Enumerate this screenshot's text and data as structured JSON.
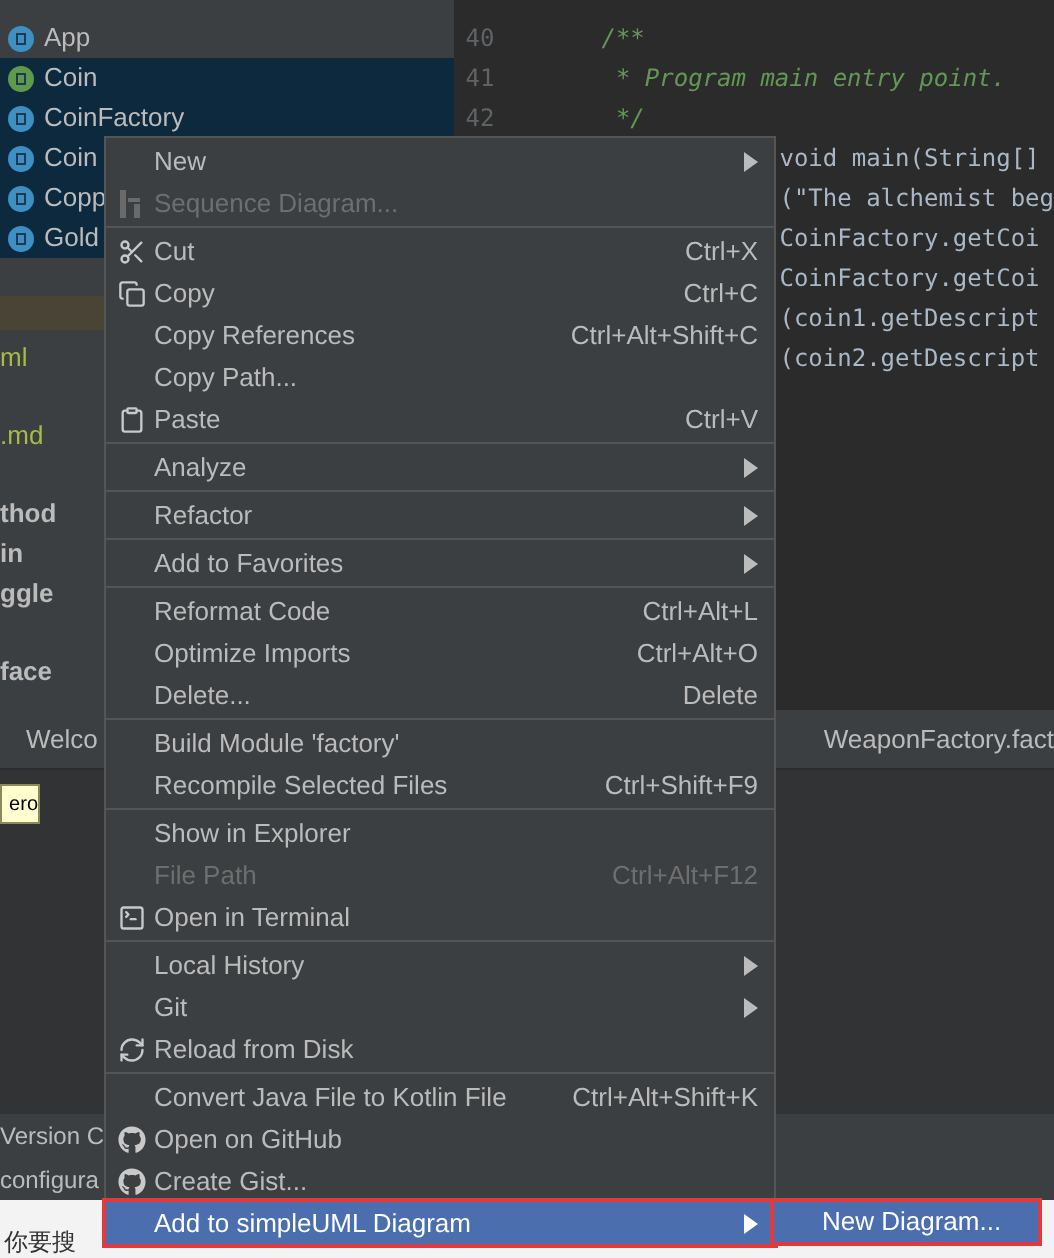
{
  "project_tree": {
    "items": [
      {
        "label": "App",
        "kind": "class",
        "selected": false
      },
      {
        "label": "Coin",
        "kind": "interface",
        "selected": true
      },
      {
        "label": "CoinFactory",
        "kind": "class",
        "selected": true
      },
      {
        "label": "Coin",
        "kind": "enum",
        "selected": true
      },
      {
        "label": "Copp",
        "kind": "class",
        "selected": true
      },
      {
        "label": "Gold",
        "kind": "class",
        "selected": true
      }
    ],
    "fragments": [
      {
        "text": "ml",
        "kind": "file"
      },
      {
        "text": ".md",
        "kind": "file"
      },
      {
        "text": "thod",
        "kind": "bold"
      },
      {
        "text": "in",
        "kind": "bold"
      },
      {
        "text": "ggle",
        "kind": "bold"
      },
      {
        "text": "face",
        "kind": "bold"
      }
    ]
  },
  "editor": {
    "lines": [
      {
        "number": "40",
        "code": "/**",
        "kind": "comment"
      },
      {
        "number": "41",
        "code": " * Program main entry point.",
        "kind": "comment"
      },
      {
        "number": "42",
        "code": " */",
        "kind": "comment"
      }
    ],
    "visible_code": [
      "void main(String[]",
      "(\"The alchemist beg",
      "CoinFactory.getCoi",
      "CoinFactory.getCoi",
      "(coin1.getDescript",
      "(coin2.getDescript"
    ]
  },
  "tool_tabs": [
    "Welco",
    "WeaponFactory.fact"
  ],
  "diagram": {
    "node": "ero"
  },
  "status_lines": [
    "Version C",
    "configura"
  ],
  "taskbar": {
    "search_text": "你要搜"
  },
  "context_menu": {
    "items": [
      {
        "kind": "plain",
        "label": "New",
        "submenu": true,
        "disabled": false,
        "selected": false
      },
      {
        "kind": "sequence",
        "label": "Sequence Diagram...",
        "submenu": false,
        "disabled": true,
        "selected": false
      },
      {
        "kind": "separator"
      },
      {
        "kind": "cut",
        "label": "Cut",
        "shortcut": "Ctrl+X",
        "submenu": false,
        "disabled": false,
        "selected": false
      },
      {
        "kind": "copy",
        "label": "Copy",
        "shortcut": "Ctrl+C",
        "submenu": false,
        "disabled": false,
        "selected": false
      },
      {
        "kind": "plain",
        "label": "Copy References",
        "shortcut": "Ctrl+Alt+Shift+C",
        "submenu": false,
        "disabled": false,
        "selected": false
      },
      {
        "kind": "plain",
        "label": "Copy Path...",
        "submenu": false,
        "disabled": false,
        "selected": false
      },
      {
        "kind": "paste",
        "label": "Paste",
        "shortcut": "Ctrl+V",
        "submenu": false,
        "disabled": false,
        "selected": false
      },
      {
        "kind": "separator"
      },
      {
        "kind": "plain",
        "label": "Analyze",
        "submenu": true,
        "disabled": false,
        "selected": false
      },
      {
        "kind": "separator"
      },
      {
        "kind": "plain",
        "label": "Refactor",
        "submenu": true,
        "disabled": false,
        "selected": false
      },
      {
        "kind": "separator"
      },
      {
        "kind": "plain",
        "label": "Add to Favorites",
        "submenu": true,
        "disabled": false,
        "selected": false
      },
      {
        "kind": "separator"
      },
      {
        "kind": "plain",
        "label": "Reformat Code",
        "shortcut": "Ctrl+Alt+L",
        "submenu": false,
        "disabled": false,
        "selected": false
      },
      {
        "kind": "plain",
        "label": "Optimize Imports",
        "shortcut": "Ctrl+Alt+O",
        "submenu": false,
        "disabled": false,
        "selected": false
      },
      {
        "kind": "plain",
        "label": "Delete...",
        "shortcut": "Delete",
        "submenu": false,
        "disabled": false,
        "selected": false
      },
      {
        "kind": "separator"
      },
      {
        "kind": "plain",
        "label": "Build Module 'factory'",
        "submenu": false,
        "disabled": false,
        "selected": false
      },
      {
        "kind": "plain",
        "label": "Recompile Selected Files",
        "shortcut": "Ctrl+Shift+F9",
        "submenu": false,
        "disabled": false,
        "selected": false
      },
      {
        "kind": "separator"
      },
      {
        "kind": "plain",
        "label": "Show in Explorer",
        "submenu": false,
        "disabled": false,
        "selected": false
      },
      {
        "kind": "plain",
        "label": "File Path",
        "shortcut": "Ctrl+Alt+F12",
        "submenu": false,
        "disabled": true,
        "selected": false
      },
      {
        "kind": "terminal",
        "label": "Open in Terminal",
        "submenu": false,
        "disabled": false,
        "selected": false
      },
      {
        "kind": "separator"
      },
      {
        "kind": "plain",
        "label": "Local History",
        "submenu": true,
        "disabled": false,
        "selected": false
      },
      {
        "kind": "plain",
        "label": "Git",
        "submenu": true,
        "disabled": false,
        "selected": false
      },
      {
        "kind": "reload",
        "label": "Reload from Disk",
        "submenu": false,
        "disabled": false,
        "selected": false
      },
      {
        "kind": "separator"
      },
      {
        "kind": "plain",
        "label": "Convert Java File to Kotlin File",
        "shortcut": "Ctrl+Alt+Shift+K",
        "submenu": false,
        "disabled": false,
        "selected": false
      },
      {
        "kind": "github",
        "label": "Open on GitHub",
        "submenu": false,
        "disabled": false,
        "selected": false
      },
      {
        "kind": "github",
        "label": "Create Gist...",
        "submenu": false,
        "disabled": false,
        "selected": false
      },
      {
        "kind": "plain",
        "label": "Add to simpleUML Diagram",
        "submenu": true,
        "disabled": false,
        "selected": true
      }
    ]
  },
  "submenu": {
    "items": [
      {
        "label": "New Diagram...",
        "selected": true
      }
    ]
  }
}
